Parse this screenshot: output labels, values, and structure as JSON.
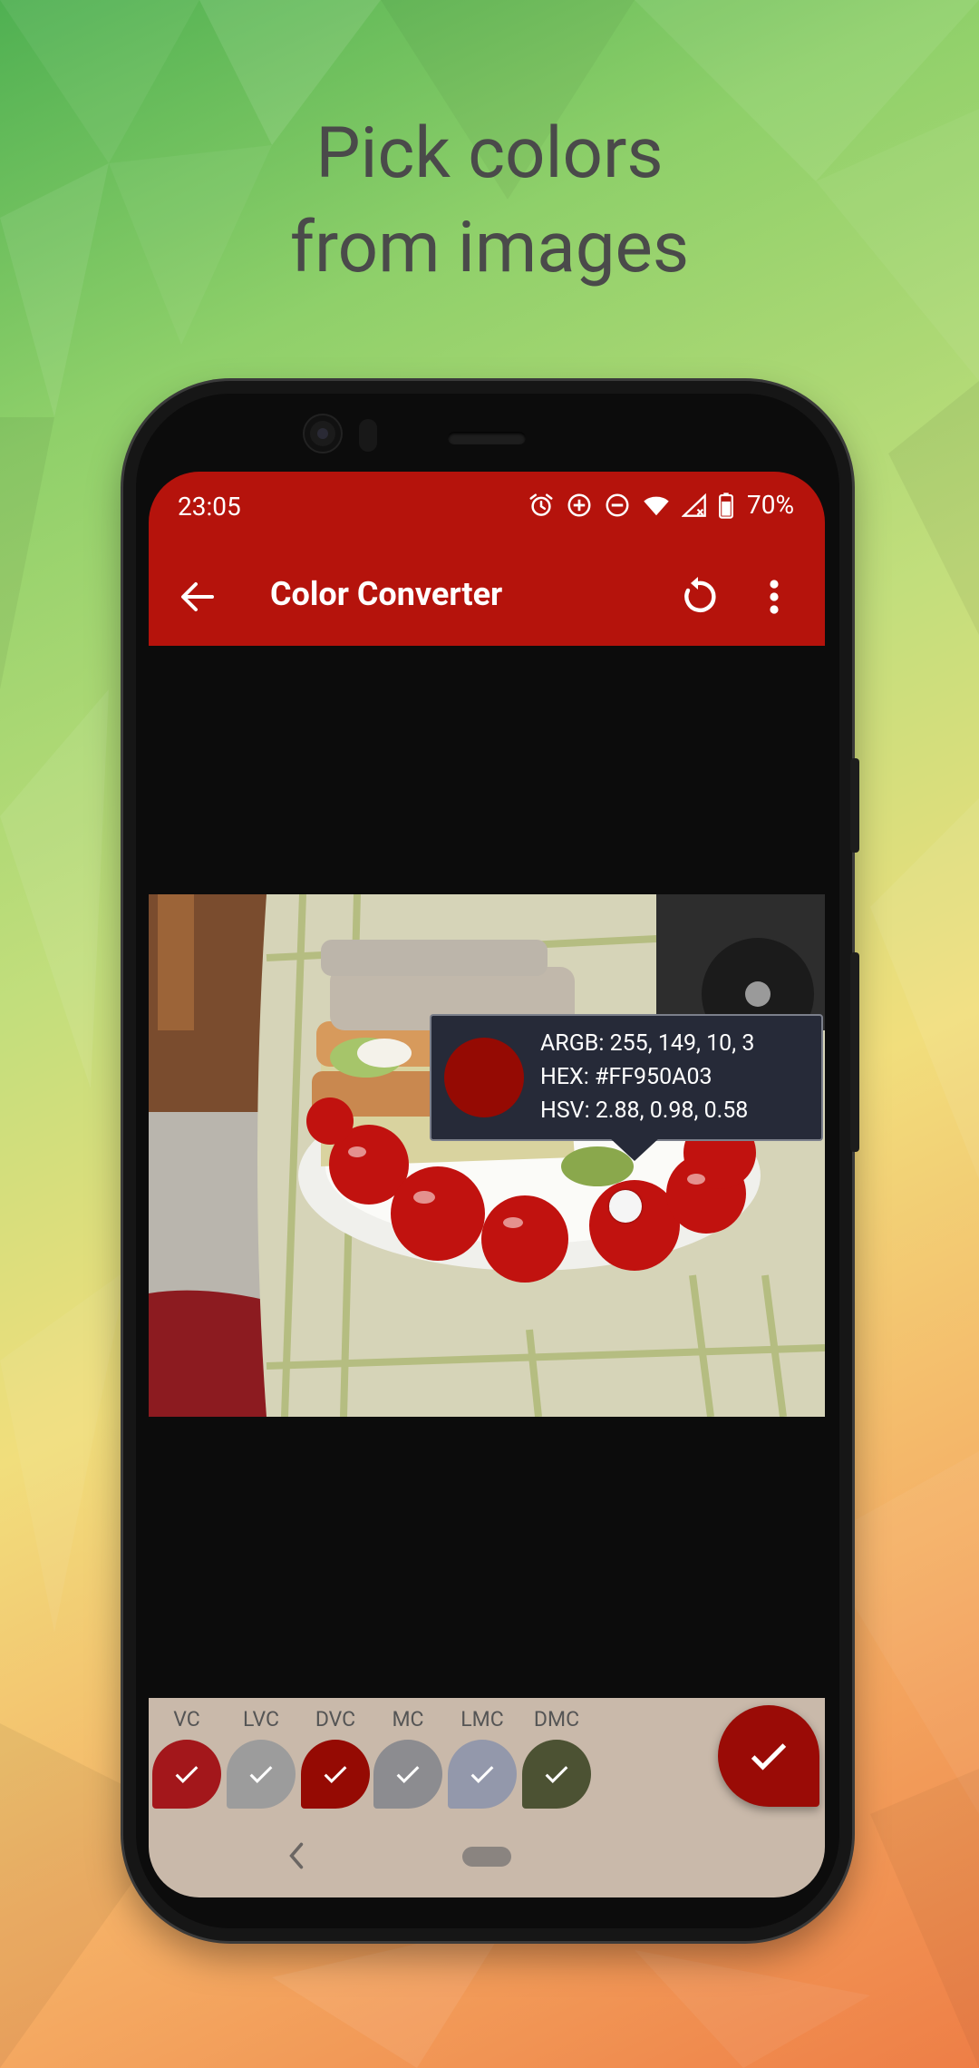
{
  "headline": {
    "line1": "Pick colors",
    "line2": "from images"
  },
  "status_bar": {
    "time": "23:05",
    "battery": "70%"
  },
  "app_bar": {
    "title": "Color Converter"
  },
  "picked_color": {
    "argb_line": "ARGB: 255, 149, 10, 3",
    "hex_line": "HEX: #FF950A03",
    "hsv_line": "HSV: 2.88, 0.98, 0.58",
    "color": "#950A03"
  },
  "palette": [
    {
      "label": "VC",
      "color": "#a3171b"
    },
    {
      "label": "LVC",
      "color": "#9c9c9c"
    },
    {
      "label": "DVC",
      "color": "#950a03"
    },
    {
      "label": "MC",
      "color": "#8c8c90"
    },
    {
      "label": "LMC",
      "color": "#9398ab"
    },
    {
      "label": "DMC",
      "color": "#4c5233"
    }
  ],
  "colors": {
    "app_bar": "#b5130c",
    "fab": "#9a0b06"
  }
}
